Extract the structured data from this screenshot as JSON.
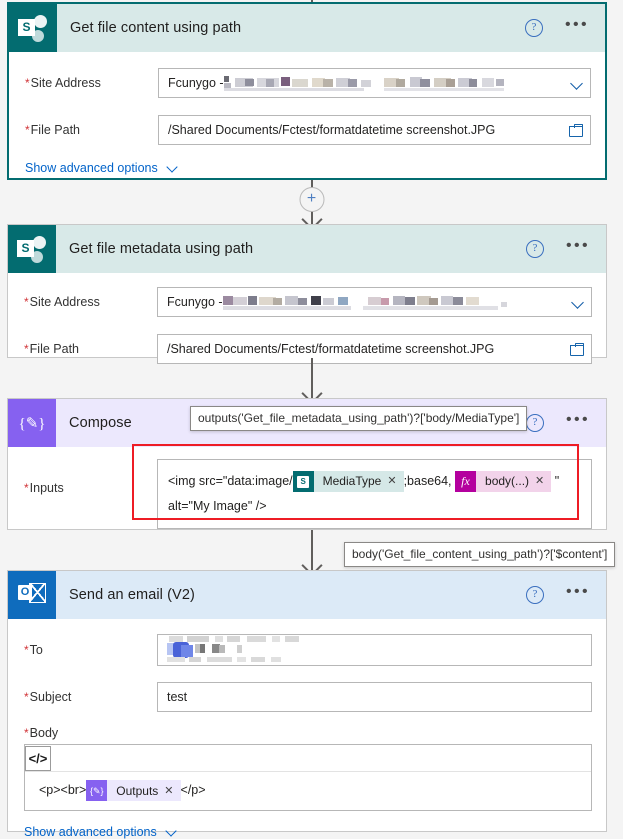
{
  "flow": {
    "cards": [
      {
        "id": "get-file-content",
        "title": "Get file content using path",
        "connector_icon": "sharepoint-icon",
        "help_icon": "?",
        "more_icon": "•••",
        "selected": true,
        "fields": [
          {
            "label": "Site Address",
            "required": true,
            "value": "Fcunygo - ",
            "redacted": true,
            "control": "dropdown",
            "control_icon": "chevron-down-icon"
          },
          {
            "label": "File Path",
            "required": true,
            "value": "/Shared Documents/Fctest/formatdatetime screenshot.JPG",
            "redacted": false,
            "control": "picker",
            "control_icon": "folder-icon"
          }
        ],
        "advanced_label": "Show advanced options"
      },
      {
        "id": "get-file-metadata",
        "title": "Get file metadata using path",
        "connector_icon": "sharepoint-icon",
        "help_icon": "?",
        "more_icon": "•••",
        "selected": false,
        "fields": [
          {
            "label": "Site Address",
            "required": true,
            "value": "Fcunygo - ",
            "redacted": true,
            "control": "dropdown",
            "control_icon": "chevron-down-icon"
          },
          {
            "label": "File Path",
            "required": true,
            "value": "/Shared Documents/Fctest/formatdatetime screenshot.JPG",
            "redacted": false,
            "control": "picker",
            "control_icon": "folder-icon"
          }
        ],
        "advanced_label": ""
      },
      {
        "id": "compose",
        "title": "Compose",
        "connector_icon": "compose-braces-icon",
        "help_icon": "?",
        "more_icon": "•••",
        "selected": false,
        "inputs_label": "Inputs",
        "inputs_required": true,
        "expression_parts": {
          "prefix": "<img src=\"data:image/",
          "middle": ";base64,",
          "suffix": "\"",
          "line2": "alt=\"My Image\" />"
        },
        "tokens": [
          {
            "label": "MediaType",
            "icon": "sharepoint-icon",
            "remove": "✕",
            "style": "sp"
          },
          {
            "label": "body(...)",
            "icon": "fx",
            "remove": "✕",
            "style": "fx"
          }
        ]
      },
      {
        "id": "send-an-email",
        "title": "Send an email (V2)",
        "connector_icon": "outlook-icon",
        "help_icon": "?",
        "more_icon": "•••",
        "selected": false,
        "fields": [
          {
            "label": "To",
            "required": true,
            "value": "",
            "redacted": true,
            "control": "none"
          },
          {
            "label": "Subject",
            "required": true,
            "value": "test",
            "redacted": false,
            "control": "none"
          }
        ],
        "body_field": {
          "label": "Body",
          "required": true,
          "toolbar_button": "</>",
          "toolbar_button_name": "code-view-button",
          "prefix": "<p><br>",
          "suffix": "</p>",
          "token": {
            "label": "Outputs",
            "icon": "compose-braces-icon",
            "remove": "✕",
            "style": "cmp"
          }
        },
        "advanced_label": "Show advanced options"
      }
    ],
    "tooltips": [
      {
        "id": "mediatype-tooltip",
        "text": "outputs('Get_file_metadata_using_path')?['body/MediaType']"
      },
      {
        "id": "content-tooltip",
        "text": "body('Get_file_content_using_path')?['$content']"
      }
    ],
    "connectors": [
      {
        "id": "connector-1-2",
        "has_plus": true,
        "plus_label": "+"
      },
      {
        "id": "connector-2-3",
        "has_plus": false,
        "plus_label": ""
      },
      {
        "id": "connector-3-4",
        "has_plus": false,
        "plus_label": ""
      }
    ],
    "colors": {
      "sharepoint": "#036c70",
      "sharepoint_header": "#d8e9e8",
      "compose": "#8661f0",
      "compose_header": "#ece8fd",
      "outlook": "#0f6cbd",
      "outlook_header": "#dceaf7",
      "annotation": "#ee1c25",
      "link": "#0263c9",
      "required": "#d13438",
      "canvas": "#f4f4f4"
    }
  }
}
